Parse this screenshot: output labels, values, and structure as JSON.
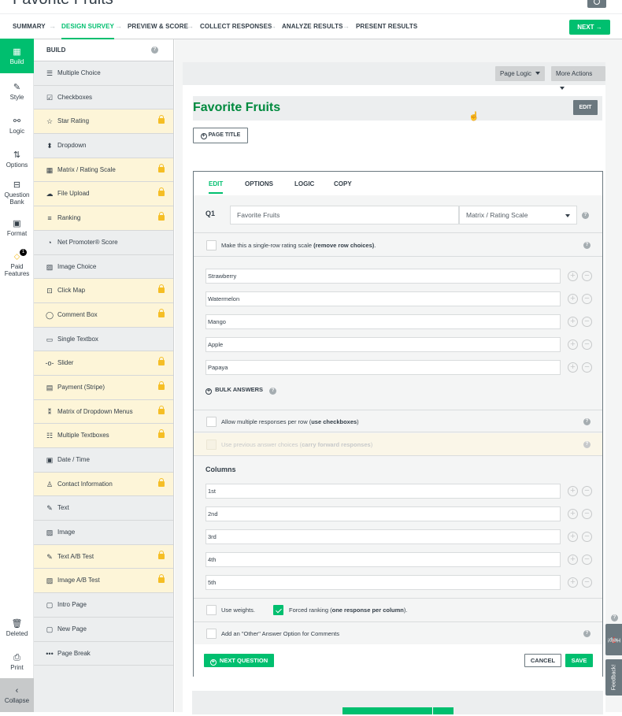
{
  "survey": {
    "title": "Favorite Fruits"
  },
  "nav": {
    "steps": [
      "SUMMARY",
      "DESIGN SURVEY",
      "PREVIEW & SCORE",
      "COLLECT RESPONSES",
      "ANALYZE RESULTS",
      "PRESENT RESULTS"
    ],
    "active_step": "DESIGN SURVEY",
    "next_label": "NEXT",
    "arrow": "→"
  },
  "rail": {
    "items": [
      {
        "label": "Build",
        "icon": "build-icon",
        "glyph": "▦"
      },
      {
        "label": "Style",
        "icon": "brush-icon",
        "glyph": "✎"
      },
      {
        "label": "Logic",
        "icon": "logic-icon",
        "glyph": "⚯"
      },
      {
        "label": "Options",
        "icon": "sliders-icon",
        "glyph": "⇅"
      },
      {
        "label": "Question",
        "label2": "Bank",
        "icon": "question-bank-icon",
        "glyph": "⊟"
      },
      {
        "label": "Format",
        "icon": "format-icon",
        "glyph": "▣"
      },
      {
        "label": "Paid",
        "label2": "Features",
        "icon": "tag-icon",
        "glyph": "⬦",
        "badge": "1"
      },
      {
        "label": "Deleted",
        "icon": "trash-icon",
        "glyph": "🗑"
      },
      {
        "label": "Print",
        "icon": "print-icon",
        "glyph": "⎙"
      },
      {
        "label": "Collapse",
        "icon": "chevron-left-icon",
        "glyph": "‹"
      }
    ]
  },
  "build": {
    "header": "BUILD",
    "help": "?",
    "items": [
      {
        "label": "Multiple Choice",
        "glyph": "☰",
        "paid": false
      },
      {
        "label": "Checkboxes",
        "glyph": "☑",
        "paid": false
      },
      {
        "label": "Star Rating",
        "glyph": "☆",
        "paid": true
      },
      {
        "label": "Dropdown",
        "glyph": "⬍",
        "paid": false
      },
      {
        "label": "Matrix / Rating Scale",
        "glyph": "▦",
        "paid": true
      },
      {
        "label": "File Upload",
        "glyph": "☁",
        "paid": true
      },
      {
        "label": "Ranking",
        "glyph": "≡",
        "paid": true
      },
      {
        "label": "Net Promoter® Score",
        "glyph": "◔",
        "paid": false
      },
      {
        "label": "Image Choice",
        "glyph": "▨",
        "paid": false
      },
      {
        "label": "Click Map",
        "glyph": "⊡",
        "paid": true
      },
      {
        "label": "Comment Box",
        "glyph": "◯",
        "paid": true
      },
      {
        "label": "Single Textbox",
        "glyph": "▭",
        "paid": false
      },
      {
        "label": "Slider",
        "glyph": "-o-",
        "paid": true
      },
      {
        "label": "Payment (Stripe)",
        "glyph": "▤",
        "paid": true
      },
      {
        "label": "Matrix of Dropdown Menus",
        "glyph": "⁑",
        "paid": true
      },
      {
        "label": "Multiple Textboxes",
        "glyph": "☷",
        "paid": true
      },
      {
        "label": "Date / Time",
        "glyph": "▣",
        "paid": false
      },
      {
        "label": "Contact Information",
        "glyph": "♙",
        "paid": true
      },
      {
        "label": "Text",
        "glyph": "✎",
        "paid": false
      },
      {
        "label": "Image",
        "glyph": "▨",
        "paid": false
      },
      {
        "label": "Text A/B Test",
        "glyph": "✎",
        "paid": true
      },
      {
        "label": "Image A/B Test",
        "glyph": "▨",
        "paid": true
      },
      {
        "label": "Intro Page",
        "glyph": "▢",
        "paid": false
      },
      {
        "label": "New Page",
        "glyph": "▢",
        "paid": false
      },
      {
        "label": "Page Break",
        "glyph": "•••",
        "paid": false
      }
    ]
  },
  "page": {
    "page_logic": "Page Logic",
    "more_actions": "More Actions",
    "title": "Favorite Fruits",
    "edit": "EDIT",
    "page_title_btn": "PAGE TITLE"
  },
  "editor": {
    "tabs": [
      "EDIT",
      "OPTIONS",
      "LOGIC",
      "COPY"
    ],
    "active_tab": "EDIT",
    "question_number": "Q1",
    "question_text": "Favorite Fruits",
    "question_type": "Matrix / Rating Scale",
    "single_row": {
      "text": "Make this a single-row rating scale ",
      "bold": "(remove row choices)",
      "after": ".",
      "checked": false
    },
    "rows": [
      "Strawberry",
      "Watermelon",
      "Mango",
      "Apple",
      "Papaya"
    ],
    "bulk_answers": "BULK ANSWERS",
    "multi_responses": {
      "text": "Allow multiple responses per row (",
      "bold": "use checkboxes",
      "after": ")",
      "checked": false
    },
    "carry_forward": {
      "text": "Use previous answer choices (",
      "bold": "carry forward responses",
      "after": ")",
      "checked": false,
      "disabled": true
    },
    "columns_title": "Columns",
    "columns": [
      "1st",
      "2nd",
      "3rd",
      "4th",
      "5th"
    ],
    "use_weights": {
      "text": "Use weights.",
      "checked": false
    },
    "forced_ranking": {
      "text": "Forced ranking (",
      "bold": "one response per column",
      "after": ").",
      "checked": true
    },
    "other_option": {
      "text": "Add an \"Other\" Answer Option for Comments",
      "checked": false
    },
    "next_question": "NEXT QUESTION",
    "cancel": "CANCEL",
    "save": "SAVE"
  },
  "side_tabs": {
    "help": "Help!",
    "feedback": "Feedback!"
  },
  "colors": {
    "accent": "#00bf6f",
    "title_green": "#008a3e",
    "paid_bg": "#fdf5d8",
    "lock": "#f5be25",
    "slate": "#6b787f"
  }
}
